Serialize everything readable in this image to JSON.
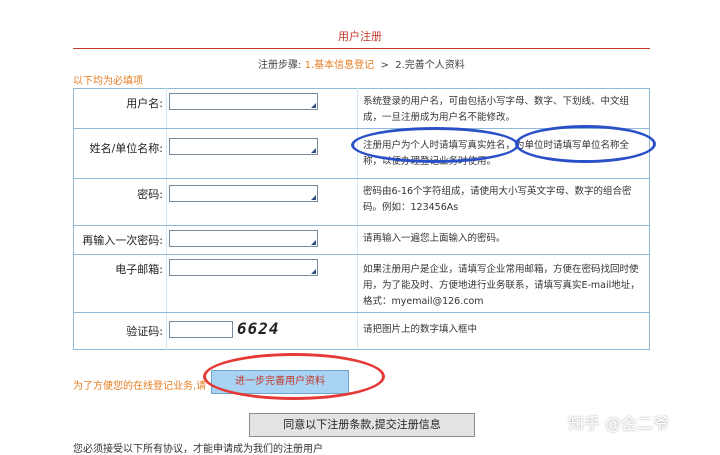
{
  "page": {
    "title": "用户注册"
  },
  "steps": {
    "label": "注册步骤:",
    "step1": "1.基本信息登记",
    "separator": ">",
    "step2": "2.完善个人资料"
  },
  "required_note": "以下均为必填项",
  "fields": [
    {
      "label": "用户名:",
      "hint": "系统登录的用户名，可由包括小写字母、数字、下划线、中文组成，一旦注册成为用户名不能修改。"
    },
    {
      "label": "姓名/单位名称:",
      "hint": "注册用户为个人时请填写真实姓名，为单位时请填写单位名称全称，以便办理登记业务时使用。"
    },
    {
      "label": "密码:",
      "hint": "密码由6-16个字符组成，请使用大小写英文字母、数字的组合密码。例如：123456As"
    },
    {
      "label": "再输入一次密码:",
      "hint": "请再输入一遍您上面输入的密码。"
    },
    {
      "label": "电子邮箱:",
      "hint": "如果注册用户是企业，请填写企业常用邮箱，方便在密码找回时使用，为了能及时、方便地进行业务联系，请填写真实E-mail地址，格式：myemail@126.com"
    },
    {
      "label": "验证码:",
      "hint": "请把图片上的数字填入框中"
    }
  ],
  "captcha": {
    "code": "6624"
  },
  "bottom": {
    "prompt": "为了方便您的在线登记业务,请",
    "complete_button": "进一步完善用户资料",
    "agree_button": "同意以下注册条款,提交注册信息",
    "notice": "您必须接受以下所有协议，才能申请成为我们的注册用户"
  },
  "watermark": "知乎 @企二爷",
  "colors": {
    "accent_orange": "#e67e22",
    "title_red": "#c0392b",
    "border_blue": "#8fb9d9",
    "annotation_blue": "#2a50c8",
    "annotation_red": "#e53935"
  }
}
